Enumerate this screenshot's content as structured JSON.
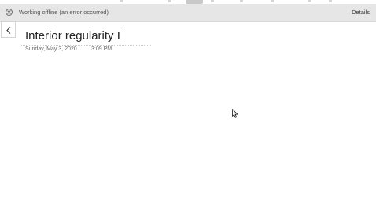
{
  "banner": {
    "message": "Working offline (an error occurred)",
    "details_label": "Details",
    "icon": "offline-status-icon"
  },
  "navigation": {
    "back_icon": "chevron-left-icon"
  },
  "page": {
    "title": "Interior regularity I",
    "date": "Sunday, May 3, 2020",
    "time": "3:09 PM"
  },
  "colors": {
    "banner_bg": "#e6e6e6",
    "page_bg": "#ffffff",
    "text": "#222222",
    "meta_text": "#666666"
  }
}
